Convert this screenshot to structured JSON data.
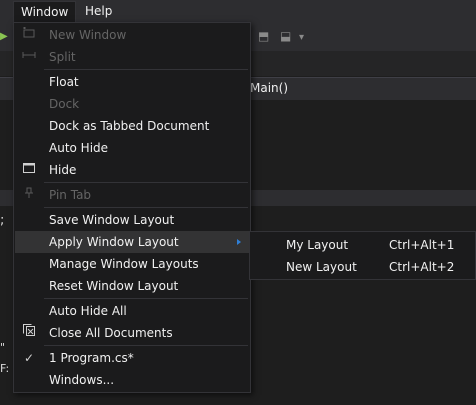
{
  "menubar": {
    "items": [
      {
        "label": "Window",
        "open": true
      },
      {
        "label": "Help",
        "open": false
      }
    ]
  },
  "editor": {
    "nav_text": "Main()",
    "fragments": [
      ";",
      "\"",
      "F:"
    ]
  },
  "window_menu": {
    "items": [
      {
        "label": "New Window",
        "enabled": false,
        "icon": "new-window-icon"
      },
      {
        "label": "Split",
        "enabled": false,
        "icon": "split-icon"
      },
      {
        "label": "Float",
        "enabled": true
      },
      {
        "label": "Dock",
        "enabled": false
      },
      {
        "label": "Dock as Tabbed Document",
        "enabled": true
      },
      {
        "label": "Auto Hide",
        "enabled": true
      },
      {
        "label": "Hide",
        "enabled": true,
        "icon": "hide-window-icon"
      },
      {
        "label": "Pin Tab",
        "enabled": false,
        "icon": "pin-icon"
      },
      {
        "label": "Save Window Layout",
        "enabled": true
      },
      {
        "label": "Apply Window Layout",
        "enabled": true,
        "submenu": true,
        "highlighted": true
      },
      {
        "label": "Manage Window Layouts",
        "enabled": true
      },
      {
        "label": "Reset Window Layout",
        "enabled": true
      },
      {
        "label": "Auto Hide All",
        "enabled": true
      },
      {
        "label": "Close All Documents",
        "enabled": true,
        "icon": "close-all-documents-icon"
      },
      {
        "label": "1 Program.cs*",
        "enabled": true,
        "checked": true,
        "icon": "checkmark-icon"
      },
      {
        "label": "Windows...",
        "enabled": true
      }
    ]
  },
  "apply_layout_submenu": {
    "items": [
      {
        "label": "My Layout",
        "shortcut": "Ctrl+Alt+1"
      },
      {
        "label": "New Layout",
        "shortcut": "Ctrl+Alt+2"
      }
    ]
  },
  "colors": {
    "menu_bg": "#1b1b1c",
    "menu_border": "#333337",
    "highlight": "#333334",
    "disabled_text": "#656565",
    "submenu_arrow": "#2f7fd6"
  }
}
